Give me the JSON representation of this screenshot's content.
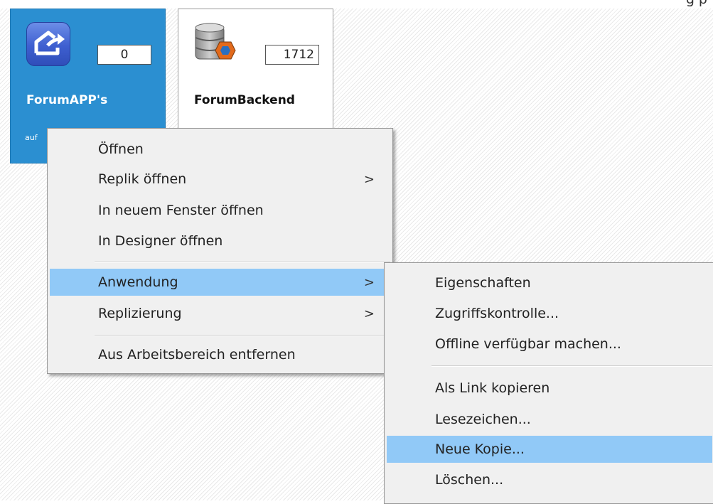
{
  "header_fragment": "g        p",
  "tiles": [
    {
      "title": "ForumAPP's",
      "count": "0",
      "subtitle": "auf",
      "icon": "home-arrow-icon"
    },
    {
      "title": "ForumBackend",
      "count": "1712",
      "icon": "database-icon"
    }
  ],
  "context_menu": {
    "items": [
      {
        "label": "Öffnen"
      },
      {
        "label": "Replik öffnen",
        "arrow": ">"
      },
      {
        "label": "In neuem Fenster öffnen"
      },
      {
        "label": "In Designer öffnen"
      },
      {
        "label": "Anwendung",
        "arrow": ">"
      },
      {
        "label": "Replizierung",
        "arrow": ">"
      },
      {
        "label": "Aus Arbeitsbereich entfernen"
      }
    ]
  },
  "submenu": {
    "items": [
      {
        "label": "Eigenschaften"
      },
      {
        "label": "Zugriffskontrolle..."
      },
      {
        "label": "Offline verfügbar machen..."
      },
      {
        "label": "Als Link kopieren"
      },
      {
        "label": "Lesezeichen..."
      },
      {
        "label": "Neue Kopie..."
      },
      {
        "label": "Löschen..."
      }
    ]
  },
  "colors": {
    "tile_blue": "#2b8fd1",
    "menu_bg": "#f0f0f0",
    "highlight": "#91c9f7"
  }
}
